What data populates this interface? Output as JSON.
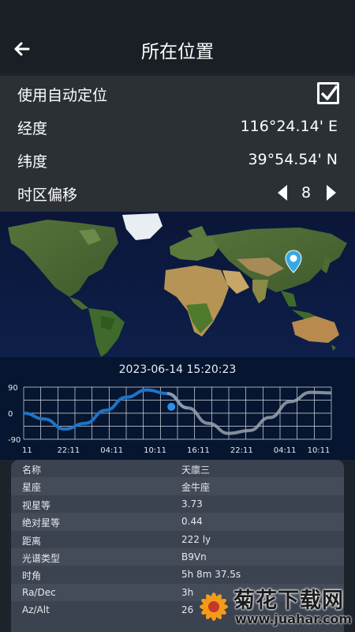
{
  "header": {
    "title": "所在位置"
  },
  "settings": {
    "auto_location_label": "使用自动定位",
    "auto_location_checked": true,
    "longitude_label": "经度",
    "longitude_value": "116°24.14' E",
    "latitude_label": "纬度",
    "latitude_value": "39°54.54' N",
    "timezone_label": "时区偏移",
    "timezone_value": "8"
  },
  "chart_header": {
    "datetime": "2023-06-14 15:20:23"
  },
  "chart_data": {
    "type": "line",
    "yticks": [
      "90",
      "0",
      "-90"
    ],
    "ylim": [
      -90,
      90
    ],
    "xticks": [
      "11",
      "22:11",
      "04:11",
      "10:11",
      "16:11",
      "22:11",
      "04:11",
      "10:11"
    ],
    "series": [
      {
        "values": [
          0,
          -20,
          -55,
          -35,
          10,
          55,
          80,
          68,
          18,
          -35,
          -70,
          -60,
          -15,
          40,
          72,
          70
        ]
      }
    ],
    "current_marker": {
      "index": 7.2,
      "value": 22
    }
  },
  "info": {
    "rows": [
      {
        "key": "名称",
        "value": "天廪三"
      },
      {
        "key": "星座",
        "value": "金牛座"
      },
      {
        "key": "视星等",
        "value": "3.73"
      },
      {
        "key": "绝对星等",
        "value": "0.44"
      },
      {
        "key": "距离",
        "value": "222  ly"
      },
      {
        "key": "光谱类型",
        "value": "B9Vn"
      },
      {
        "key": "时角",
        "value": "5h 8m 37.5s"
      },
      {
        "key": "Ra/Dec",
        "value": "3h"
      },
      {
        "key": "Az/Alt",
        "value": "26"
      }
    ]
  },
  "watermark": {
    "text": "菊花下载网",
    "url": "www.juahar.com"
  },
  "colors": {
    "accent": "#1e73c8",
    "marker": "#2f8fe6",
    "location_pin": "#35a9e0"
  }
}
